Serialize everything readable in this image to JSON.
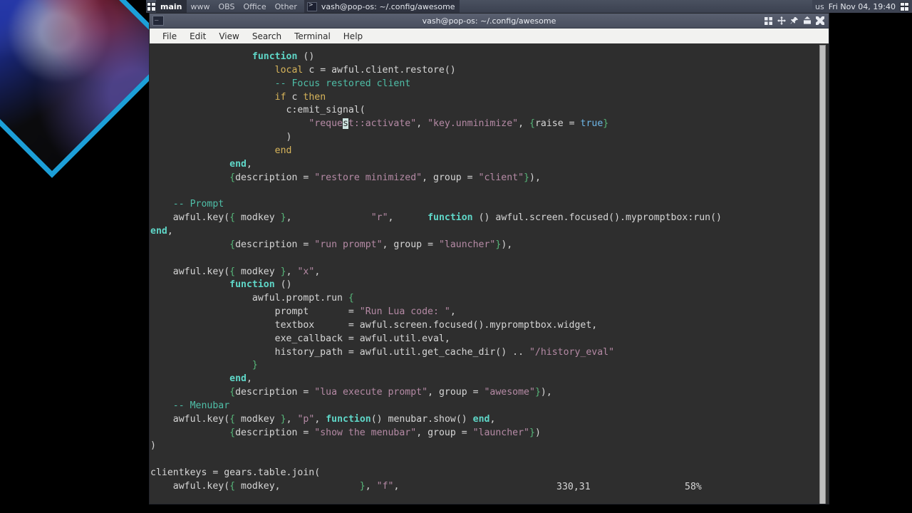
{
  "wibar": {
    "layout_icon": "layout-tile-icon",
    "tags": [
      "main",
      "www",
      "OBS",
      "Office",
      "Other"
    ],
    "selected_tag": "main",
    "task": {
      "icon": "terminal-icon",
      "label": "vash@pop-os: ~/.config/awesome"
    },
    "keyboard_layout": "us",
    "clock": "Fri Nov 04, 19:40",
    "layoutbox_icon": "layout-tile-icon"
  },
  "window": {
    "icon": "terminal-icon",
    "title": "vash@pop-os: ~/.config/awesome",
    "buttons": [
      {
        "name": "floating-button",
        "glyph": "tile"
      },
      {
        "name": "sticky-button",
        "glyph": "move"
      },
      {
        "name": "ontop-button",
        "glyph": "pin"
      },
      {
        "name": "maximize-button",
        "glyph": "maximize"
      },
      {
        "name": "close-button",
        "glyph": "close"
      }
    ],
    "menu": [
      "File",
      "Edit",
      "View",
      "Search",
      "Terminal",
      "Help"
    ]
  },
  "editor": {
    "status": {
      "position": "330,31",
      "percent": "58%"
    },
    "cursor": {
      "line_index": 5,
      "char": "s",
      "in_token": "\"request::activate\""
    },
    "colors": {
      "background": "#2e2e2e",
      "foreground": "#d6d6d6",
      "keyword": "#5fd7c8",
      "keyword_alt": "#d7b45a",
      "comment": "#4fbfa8",
      "string": "#b58aa5",
      "number": "#6fb8e8",
      "brace": "#57b87a",
      "cursor_bg": "#cfe6e2"
    },
    "lines": [
      [
        {
          "t": "                  ",
          "c": "pl"
        },
        {
          "t": "function",
          "c": "kw"
        },
        {
          "t": " ()",
          "c": "pl"
        }
      ],
      [
        {
          "t": "                      ",
          "c": "pl"
        },
        {
          "t": "local",
          "c": "kw2"
        },
        {
          "t": " c = awful.client.restore()",
          "c": "pl"
        }
      ],
      [
        {
          "t": "                      ",
          "c": "pl"
        },
        {
          "t": "-- Focus restored client",
          "c": "cmt"
        }
      ],
      [
        {
          "t": "                      ",
          "c": "pl"
        },
        {
          "t": "if",
          "c": "kw2"
        },
        {
          "t": " c ",
          "c": "pl"
        },
        {
          "t": "then",
          "c": "kw2"
        }
      ],
      [
        {
          "t": "                        c:emit_signal(",
          "c": "pl"
        }
      ],
      [
        {
          "t": "                            ",
          "c": "pl"
        },
        {
          "t": "\"reque",
          "c": "str"
        },
        {
          "t": "s",
          "c": "cur"
        },
        {
          "t": "t::activate\"",
          "c": "str"
        },
        {
          "t": ", ",
          "c": "pl"
        },
        {
          "t": "\"key.unminimize\"",
          "c": "str"
        },
        {
          "t": ", ",
          "c": "pl"
        },
        {
          "t": "{",
          "c": "brc"
        },
        {
          "t": "raise = ",
          "c": "pl"
        },
        {
          "t": "true",
          "c": "num"
        },
        {
          "t": "}",
          "c": "brc"
        }
      ],
      [
        {
          "t": "                        )",
          "c": "pl"
        }
      ],
      [
        {
          "t": "                      ",
          "c": "pl"
        },
        {
          "t": "end",
          "c": "kw2"
        }
      ],
      [
        {
          "t": "              ",
          "c": "pl"
        },
        {
          "t": "end",
          "c": "kw"
        },
        {
          "t": ",",
          "c": "pl"
        }
      ],
      [
        {
          "t": "              ",
          "c": "pl"
        },
        {
          "t": "{",
          "c": "brc"
        },
        {
          "t": "description = ",
          "c": "pl"
        },
        {
          "t": "\"restore minimized\"",
          "c": "str"
        },
        {
          "t": ", group = ",
          "c": "pl"
        },
        {
          "t": "\"client\"",
          "c": "str"
        },
        {
          "t": "}",
          "c": "brc"
        },
        {
          "t": "),",
          "c": "pl"
        }
      ],
      [
        {
          "t": "",
          "c": "pl"
        }
      ],
      [
        {
          "t": "    ",
          "c": "pl"
        },
        {
          "t": "-- Prompt",
          "c": "cmt"
        }
      ],
      [
        {
          "t": "    awful.key(",
          "c": "pl"
        },
        {
          "t": "{",
          "c": "brc"
        },
        {
          "t": " modkey ",
          "c": "pl"
        },
        {
          "t": "}",
          "c": "brc"
        },
        {
          "t": ",              ",
          "c": "pl"
        },
        {
          "t": "\"r\"",
          "c": "str"
        },
        {
          "t": ",      ",
          "c": "pl"
        },
        {
          "t": "function",
          "c": "kw"
        },
        {
          "t": " () awful.screen.focused().mypromptbox:run() ",
          "c": "pl"
        }
      ],
      [
        {
          "t": "end",
          "c": "kw"
        },
        {
          "t": ",",
          "c": "pl"
        }
      ],
      [
        {
          "t": "              ",
          "c": "pl"
        },
        {
          "t": "{",
          "c": "brc"
        },
        {
          "t": "description = ",
          "c": "pl"
        },
        {
          "t": "\"run prompt\"",
          "c": "str"
        },
        {
          "t": ", group = ",
          "c": "pl"
        },
        {
          "t": "\"launcher\"",
          "c": "str"
        },
        {
          "t": "}",
          "c": "brc"
        },
        {
          "t": "),",
          "c": "pl"
        }
      ],
      [
        {
          "t": "",
          "c": "pl"
        }
      ],
      [
        {
          "t": "    awful.key(",
          "c": "pl"
        },
        {
          "t": "{",
          "c": "brc"
        },
        {
          "t": " modkey ",
          "c": "pl"
        },
        {
          "t": "}",
          "c": "brc"
        },
        {
          "t": ", ",
          "c": "pl"
        },
        {
          "t": "\"x\"",
          "c": "str"
        },
        {
          "t": ",",
          "c": "pl"
        }
      ],
      [
        {
          "t": "              ",
          "c": "pl"
        },
        {
          "t": "function",
          "c": "kw"
        },
        {
          "t": " ()",
          "c": "pl"
        }
      ],
      [
        {
          "t": "                  awful.prompt.run ",
          "c": "pl"
        },
        {
          "t": "{",
          "c": "brc"
        }
      ],
      [
        {
          "t": "                      prompt       = ",
          "c": "pl"
        },
        {
          "t": "\"Run Lua code: \"",
          "c": "str"
        },
        {
          "t": ",",
          "c": "pl"
        }
      ],
      [
        {
          "t": "                      textbox      = awful.screen.focused().mypromptbox.widget,",
          "c": "pl"
        }
      ],
      [
        {
          "t": "                      exe_callback = awful.util.eval,",
          "c": "pl"
        }
      ],
      [
        {
          "t": "                      history_path = awful.util.get_cache_dir() .. ",
          "c": "pl"
        },
        {
          "t": "\"/history_eval\"",
          "c": "str"
        }
      ],
      [
        {
          "t": "                  ",
          "c": "pl"
        },
        {
          "t": "}",
          "c": "brc"
        }
      ],
      [
        {
          "t": "              ",
          "c": "pl"
        },
        {
          "t": "end",
          "c": "kw"
        },
        {
          "t": ",",
          "c": "pl"
        }
      ],
      [
        {
          "t": "              ",
          "c": "pl"
        },
        {
          "t": "{",
          "c": "brc"
        },
        {
          "t": "description = ",
          "c": "pl"
        },
        {
          "t": "\"lua execute prompt\"",
          "c": "str"
        },
        {
          "t": ", group = ",
          "c": "pl"
        },
        {
          "t": "\"awesome\"",
          "c": "str"
        },
        {
          "t": "}",
          "c": "brc"
        },
        {
          "t": "),",
          "c": "pl"
        }
      ],
      [
        {
          "t": "    ",
          "c": "pl"
        },
        {
          "t": "-- Menubar",
          "c": "cmt"
        }
      ],
      [
        {
          "t": "    awful.key(",
          "c": "pl"
        },
        {
          "t": "{",
          "c": "brc"
        },
        {
          "t": " modkey ",
          "c": "pl"
        },
        {
          "t": "}",
          "c": "brc"
        },
        {
          "t": ", ",
          "c": "pl"
        },
        {
          "t": "\"p\"",
          "c": "str"
        },
        {
          "t": ", ",
          "c": "pl"
        },
        {
          "t": "function",
          "c": "kw"
        },
        {
          "t": "() menubar.show() ",
          "c": "pl"
        },
        {
          "t": "end",
          "c": "kw"
        },
        {
          "t": ",",
          "c": "pl"
        }
      ],
      [
        {
          "t": "              ",
          "c": "pl"
        },
        {
          "t": "{",
          "c": "brc"
        },
        {
          "t": "description = ",
          "c": "pl"
        },
        {
          "t": "\"show the menubar\"",
          "c": "str"
        },
        {
          "t": ", group = ",
          "c": "pl"
        },
        {
          "t": "\"launcher\"",
          "c": "str"
        },
        {
          "t": "}",
          "c": "brc"
        },
        {
          "t": ")",
          "c": "pl"
        }
      ],
      [
        {
          "t": ")",
          "c": "pl"
        }
      ],
      [
        {
          "t": "",
          "c": "pl"
        }
      ],
      [
        {
          "t": "clientkeys = gears.table.join(",
          "c": "pl"
        }
      ],
      [
        {
          "t": "    awful.key(",
          "c": "pl"
        },
        {
          "t": "{",
          "c": "brc"
        },
        {
          "t": " modkey,              ",
          "c": "pl"
        },
        {
          "t": "}",
          "c": "brc"
        },
        {
          "t": ", ",
          "c": "pl"
        },
        {
          "t": "\"f\"",
          "c": "str"
        },
        {
          "t": ",",
          "c": "pl"
        }
      ]
    ]
  },
  "webcam": {
    "name": "webcam-diamond-overlay",
    "frame_color": "#1c9fd8"
  }
}
